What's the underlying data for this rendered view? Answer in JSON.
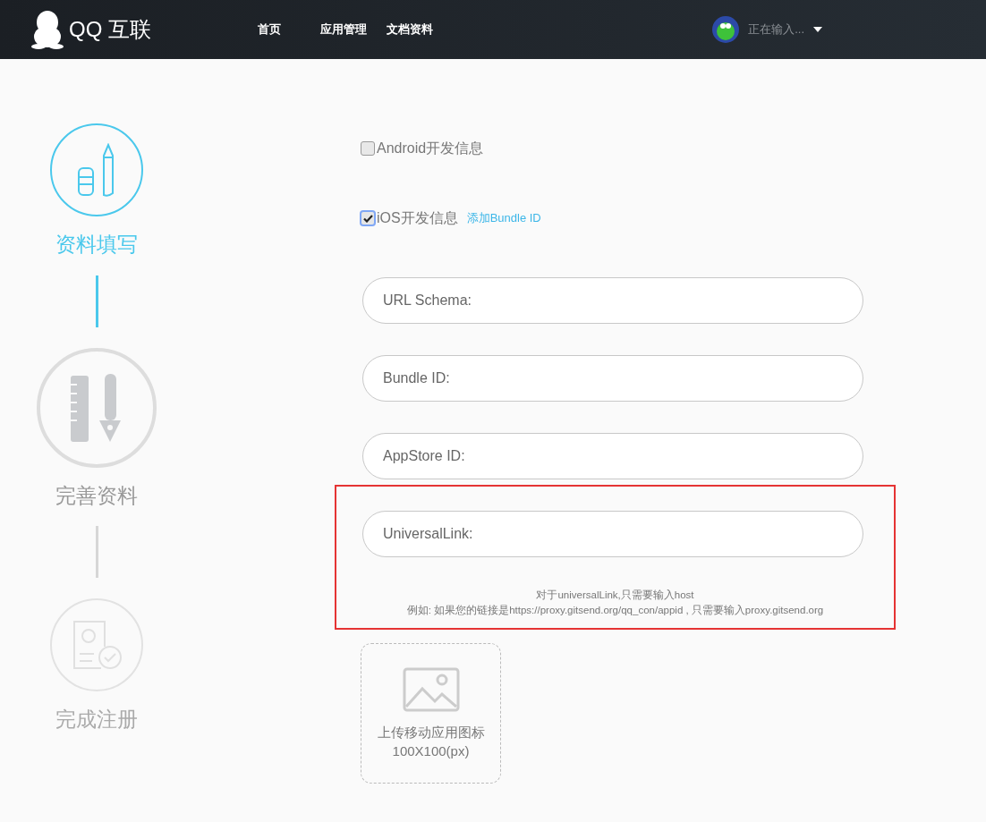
{
  "header": {
    "logo_text": "QQ 互联",
    "nav": [
      {
        "label": "首页"
      },
      {
        "label": "应用管理"
      },
      {
        "label": "文档资料"
      }
    ],
    "user": {
      "name": "正在输入..."
    }
  },
  "steps": [
    {
      "label": "资料填写",
      "kind": "done"
    },
    {
      "label": "完善资料",
      "kind": "current"
    },
    {
      "label": "完成注册",
      "kind": "pending"
    }
  ],
  "platforms": [
    {
      "label": "Android开发信息",
      "checked": false
    },
    {
      "label": "iOS开发信息",
      "checked": true,
      "link": "添加Bundle ID"
    }
  ],
  "fields": [
    {
      "placeholder": "URL Schema:",
      "highlighted": false
    },
    {
      "placeholder": "Bundle ID:",
      "highlighted": false
    },
    {
      "placeholder": "AppStore ID:",
      "highlighted": false
    },
    {
      "placeholder": "UniversalLink:",
      "highlighted": true,
      "hints": [
        "对于universalLink,只需要输入host",
        "例如: 如果您的链接是https://proxy.gitsend.org/qq_con/appid , 只需要输入proxy.gitsend.org"
      ]
    }
  ],
  "upload": {
    "lines": [
      "上传移动应用图标",
      "100X100(px)"
    ]
  }
}
